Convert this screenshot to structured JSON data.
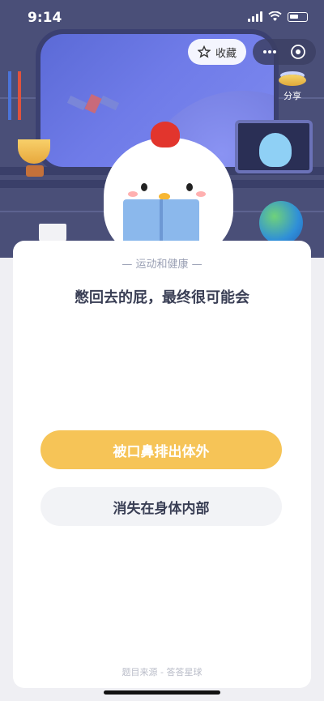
{
  "status_bar": {
    "time": "9:14"
  },
  "top_actions": {
    "favorite_label": "收藏",
    "share_label": "分享"
  },
  "quiz": {
    "category": "— 运动和健康 —",
    "question": "憋回去的屁，最终很可能会",
    "options": [
      {
        "label": "被口鼻排出体外",
        "highlighted": true
      },
      {
        "label": "消失在身体内部",
        "highlighted": false
      }
    ],
    "source": "题目来源 - 答答星球"
  },
  "colors": {
    "primary_option": "#f6c457",
    "secondary_option": "#f2f3f6",
    "hero_background": "#4a4f78"
  }
}
